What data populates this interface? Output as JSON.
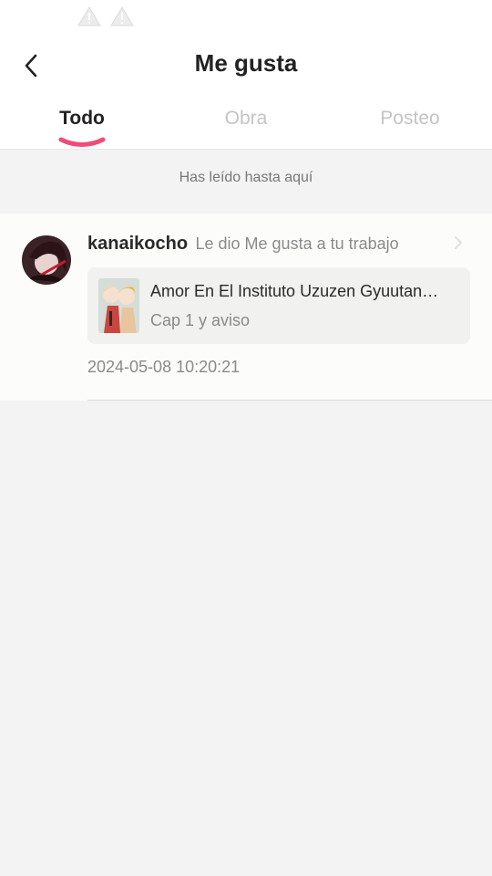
{
  "status_bar": {
    "icons": [
      "warning-icon",
      "warning-icon"
    ]
  },
  "header": {
    "title": "Me gusta",
    "back_icon": "chevron-left-icon"
  },
  "tabs": [
    {
      "label": "Todo",
      "active": true
    },
    {
      "label": "Obra",
      "active": false
    },
    {
      "label": "Posteo",
      "active": false
    }
  ],
  "colors": {
    "accent": "#ee4d7a",
    "background": "#f3f3f3",
    "card": "#fcfcfa"
  },
  "read_marker": "Has leído hasta aquí",
  "notifications": [
    {
      "username": "kanaikocho",
      "action": "Le dio Me gusta a tu trabajo",
      "work_title": "Amor En El Instituto Uzuzen Gyuutan…",
      "work_subtitle": "Cap 1 y aviso",
      "timestamp": "2024-05-08 10:20:21"
    }
  ]
}
